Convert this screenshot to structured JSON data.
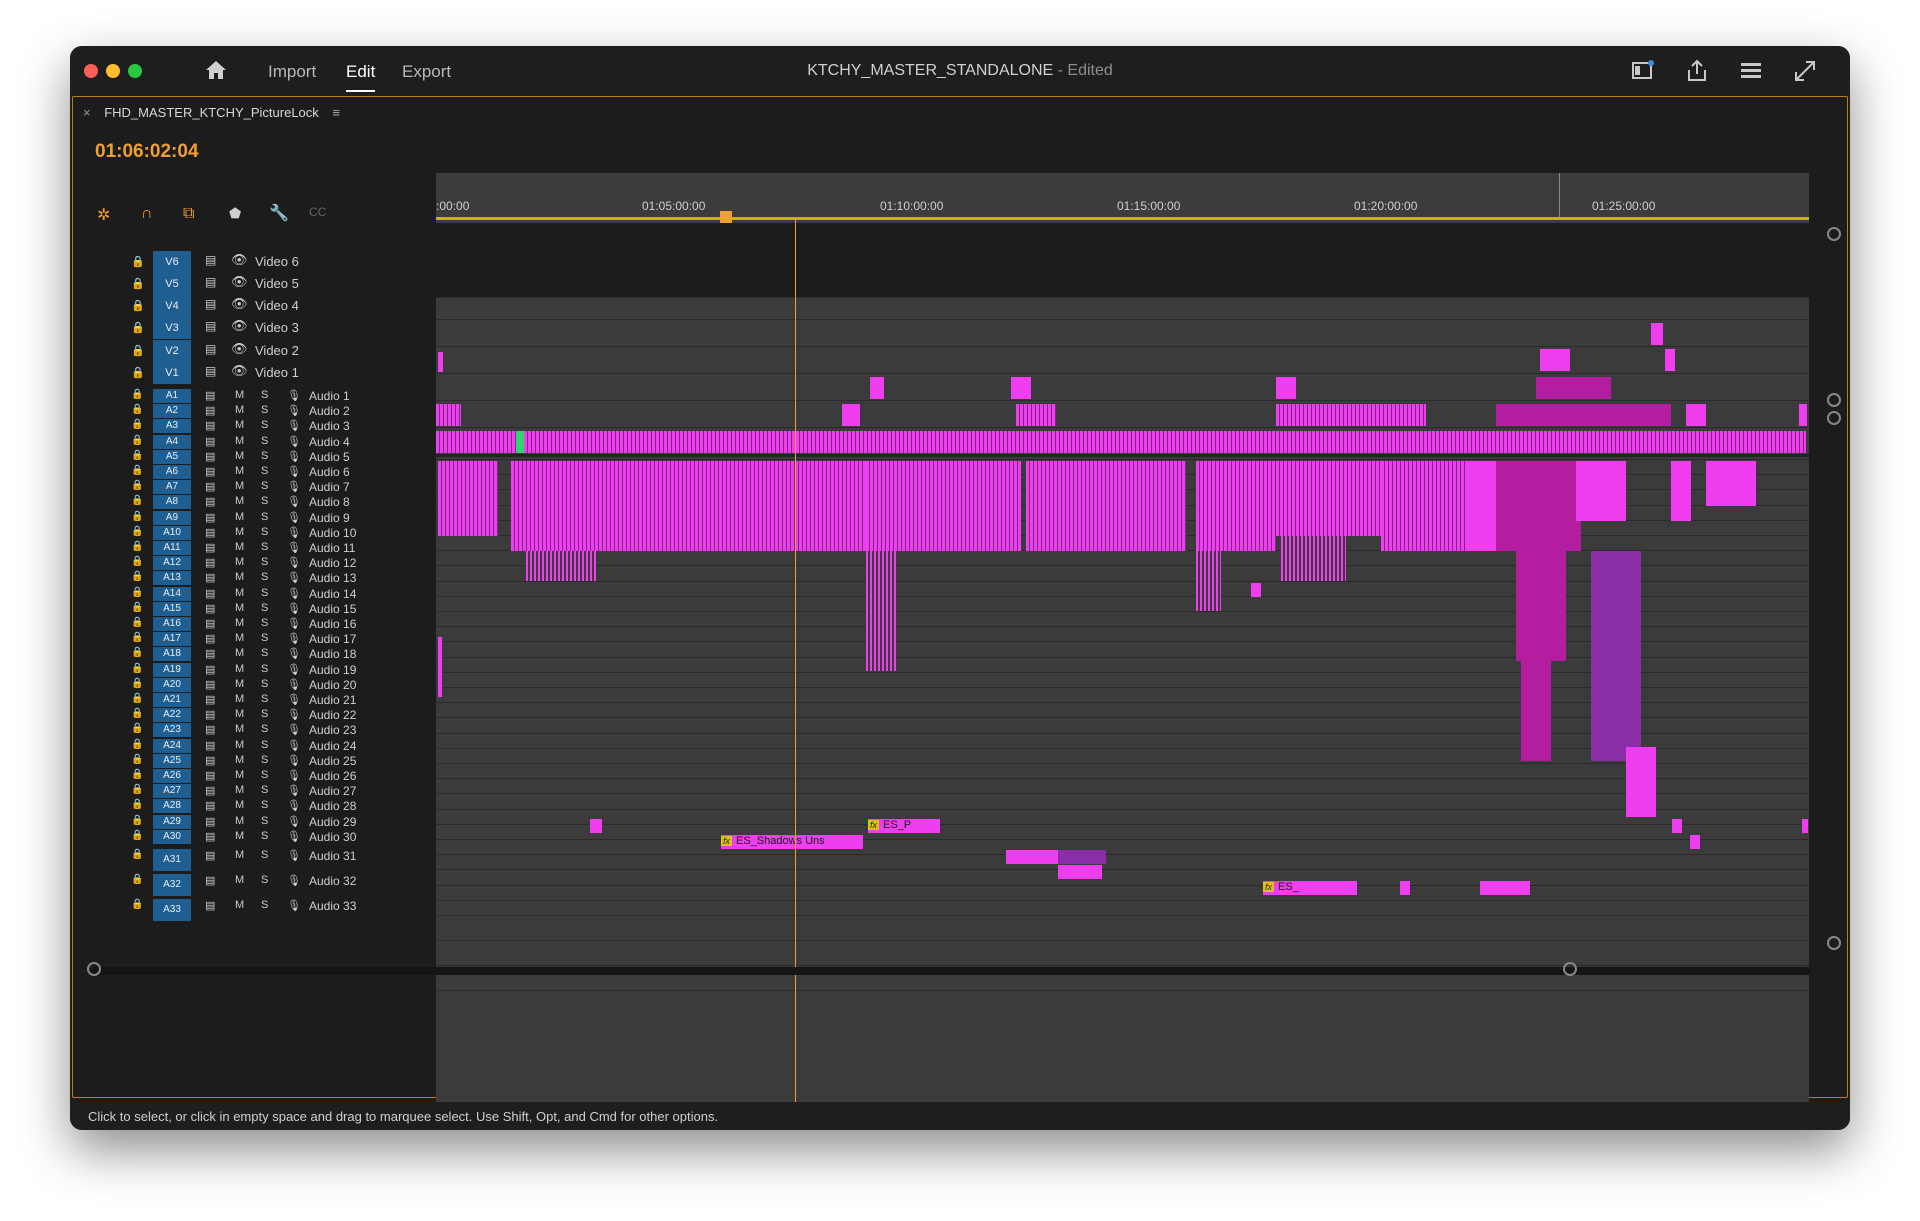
{
  "titlebar": {
    "nav": [
      "Import",
      "Edit",
      "Export"
    ],
    "active_nav": "Edit",
    "title": "KTCHY_MASTER_STANDALONE",
    "title_status": "- Edited"
  },
  "sequence": {
    "tab_name": "FHD_MASTER_KTCHY_PictureLock",
    "timecode": "01:06:02:04"
  },
  "ruler": {
    "labels": [
      ":00:00",
      "01:05:00:00",
      "01:10:00:00",
      "01:15:00:00",
      "01:20:00:00",
      "01:25:00:00"
    ]
  },
  "video_tracks": [
    {
      "id": "V6",
      "name": "Video 6"
    },
    {
      "id": "V5",
      "name": "Video 5"
    },
    {
      "id": "V4",
      "name": "Video 4"
    },
    {
      "id": "V3",
      "name": "Video 3"
    },
    {
      "id": "V2",
      "name": "Video 2"
    },
    {
      "id": "V1",
      "name": "Video 1"
    }
  ],
  "audio_tracks": [
    {
      "id": "A1",
      "name": "Audio 1"
    },
    {
      "id": "A2",
      "name": "Audio 2"
    },
    {
      "id": "A3",
      "name": "Audio 3"
    },
    {
      "id": "A4",
      "name": "Audio 4"
    },
    {
      "id": "A5",
      "name": "Audio 5"
    },
    {
      "id": "A6",
      "name": "Audio 6"
    },
    {
      "id": "A7",
      "name": "Audio 7"
    },
    {
      "id": "A8",
      "name": "Audio 8"
    },
    {
      "id": "A9",
      "name": "Audio 9"
    },
    {
      "id": "A10",
      "name": "Audio 10"
    },
    {
      "id": "A11",
      "name": "Audio 11"
    },
    {
      "id": "A12",
      "name": "Audio 12"
    },
    {
      "id": "A13",
      "name": "Audio 13"
    },
    {
      "id": "A14",
      "name": "Audio 14"
    },
    {
      "id": "A15",
      "name": "Audio 15"
    },
    {
      "id": "A16",
      "name": "Audio 16"
    },
    {
      "id": "A17",
      "name": "Audio 17"
    },
    {
      "id": "A18",
      "name": "Audio 18"
    },
    {
      "id": "A19",
      "name": "Audio 19"
    },
    {
      "id": "A20",
      "name": "Audio 20"
    },
    {
      "id": "A21",
      "name": "Audio 21"
    },
    {
      "id": "A22",
      "name": "Audio 22"
    },
    {
      "id": "A23",
      "name": "Audio 23"
    },
    {
      "id": "A24",
      "name": "Audio 24"
    },
    {
      "id": "A25",
      "name": "Audio 25"
    },
    {
      "id": "A26",
      "name": "Audio 26"
    },
    {
      "id": "A27",
      "name": "Audio 27"
    },
    {
      "id": "A28",
      "name": "Audio 28"
    },
    {
      "id": "A29",
      "name": "Audio 29"
    },
    {
      "id": "A30",
      "name": "Audio 30"
    },
    {
      "id": "A31",
      "name": "Audio 31"
    },
    {
      "id": "A32",
      "name": "Audio 32"
    },
    {
      "id": "A33",
      "name": "Audio 33"
    }
  ],
  "mute_label": "M",
  "solo_label": "S",
  "clip_labels": {
    "a26": "ES_P",
    "a27": "ES_Shadows Uns",
    "a30": "ES_"
  },
  "status_text": "Click to select, or click in empty space and drag to marquee select. Use Shift, Opt, and Cmd for other options.",
  "colors": {
    "clip": "#ef3df0",
    "clip_dark": "#8a2ea8",
    "track_badge": "#1f5e91",
    "timecode": "#f0a030",
    "panel_border": "#c8781e"
  }
}
